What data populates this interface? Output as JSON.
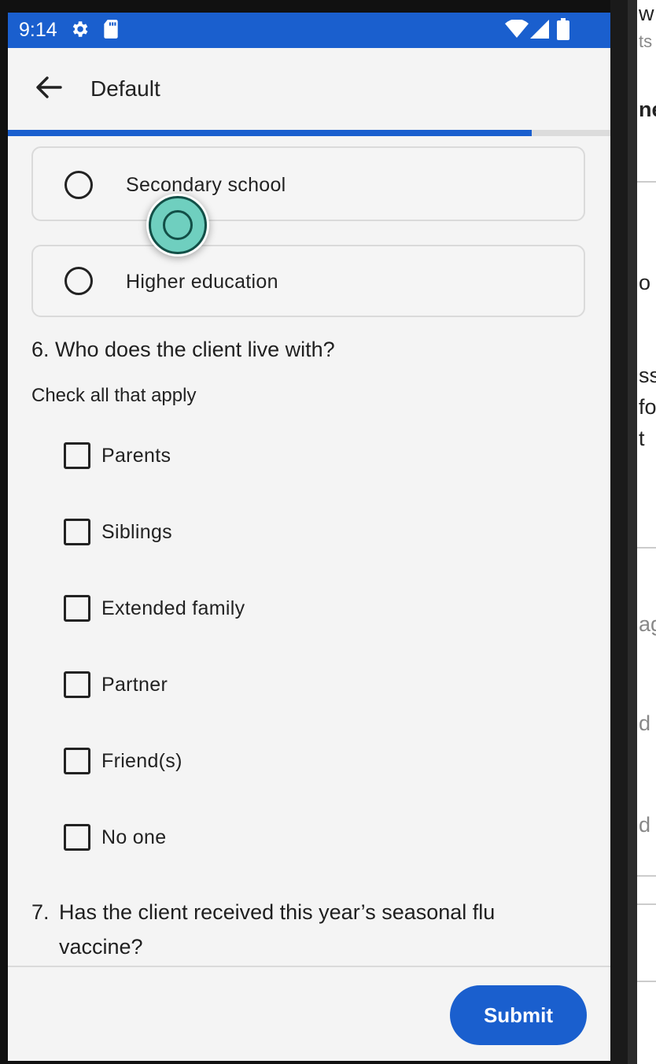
{
  "status_bar": {
    "time": "9:14",
    "icons": [
      "gear-icon",
      "sd-card-icon",
      "wifi-icon",
      "cell-signal-icon",
      "battery-icon"
    ]
  },
  "app_bar": {
    "title": "Default",
    "back_icon": "arrow-back-icon"
  },
  "progress": {
    "fraction": 0.87
  },
  "question5": {
    "options": [
      {
        "label": "Secondary school",
        "selected": false
      },
      {
        "label": "Higher education",
        "selected": false
      }
    ]
  },
  "question6": {
    "title": "6. Who does the client live with?",
    "hint": "Check all that apply",
    "options": [
      {
        "label": "Parents",
        "checked": false
      },
      {
        "label": "Siblings",
        "checked": false
      },
      {
        "label": "Extended family",
        "checked": false
      },
      {
        "label": "Partner",
        "checked": false
      },
      {
        "label": "Friend(s)",
        "checked": false
      },
      {
        "label": "No one",
        "checked": false
      }
    ]
  },
  "question7": {
    "number": "7.",
    "line1": "Has the client received this year’s seasonal flu",
    "line2": "vaccine?"
  },
  "bottom_bar": {
    "submit_label": "Submit"
  },
  "background_window": {
    "fragments": [
      "w",
      "ts",
      "ne",
      "o",
      "ss",
      "fo",
      "t",
      "ag",
      "d t",
      "d"
    ]
  },
  "colors": {
    "accent": "#1a5fce",
    "touch_indicator": "#6fcfbf",
    "touch_indicator_border": "#124f47"
  }
}
